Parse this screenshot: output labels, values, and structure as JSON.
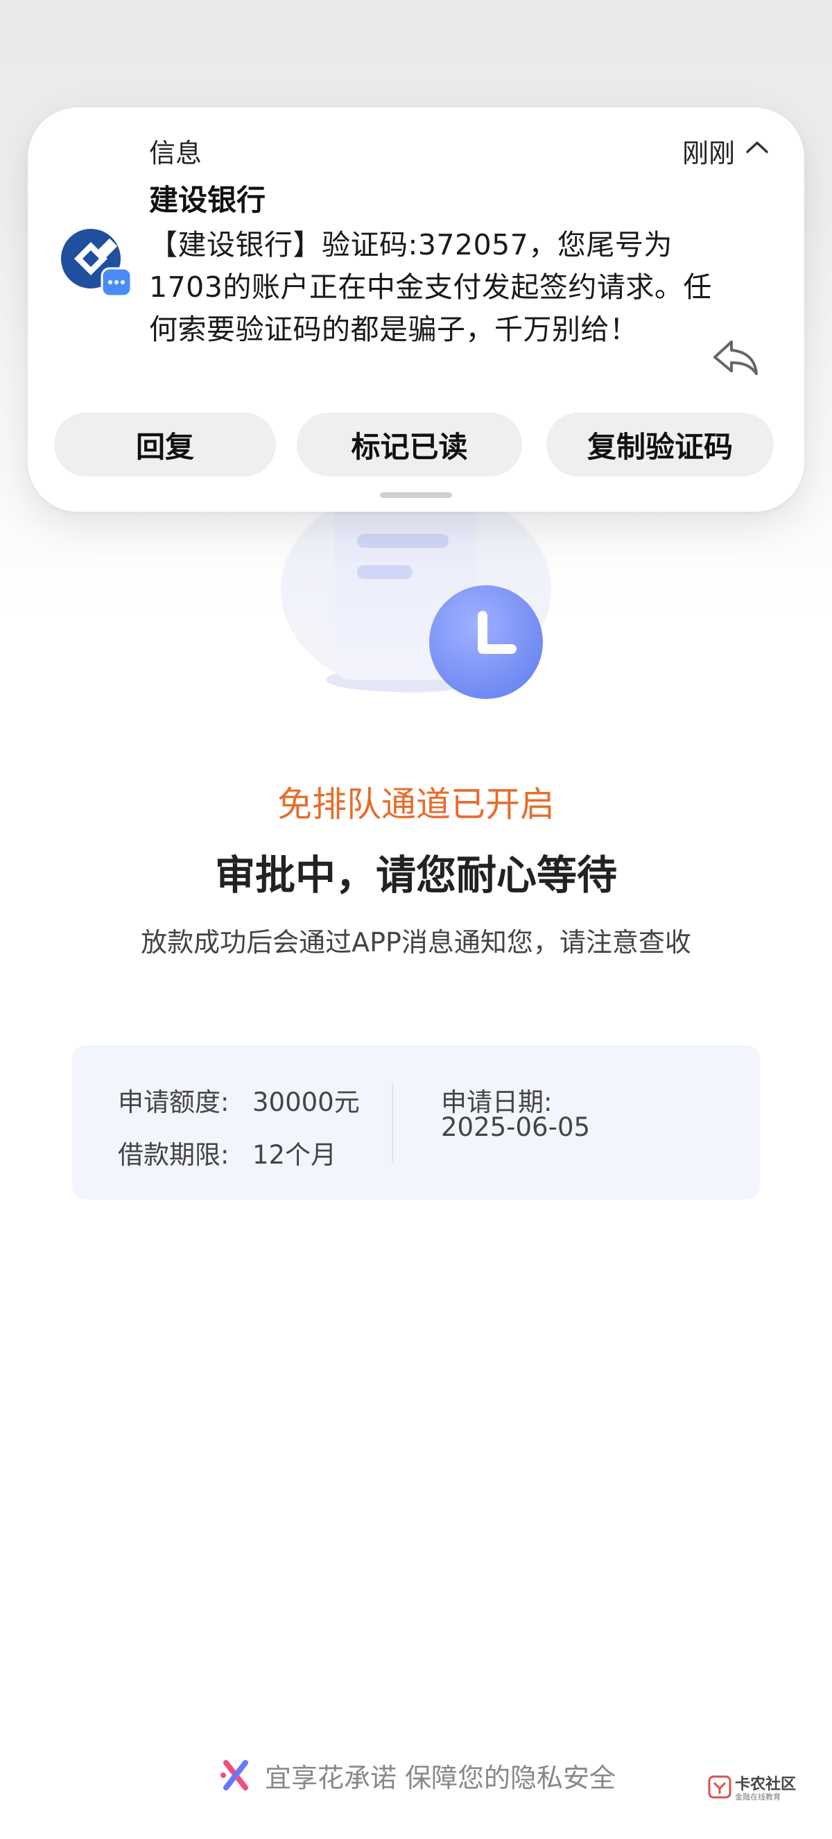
{
  "notification": {
    "app_name": "信息",
    "time": "刚刚",
    "sender": "建设银行",
    "body": "【建设银行】验证码:372057，您尾号为1703的账户正在中金支付发起签约请求。任何索要验证码的都是骗子，千万别给！",
    "actions": [
      "回复",
      "标记已读",
      "复制验证码"
    ]
  },
  "status": {
    "fast_lane": "免排队通道已开启",
    "title": "审批中，请您耐心等待",
    "subtitle": "放款成功后会通过APP消息通知您，请注意查收"
  },
  "info": {
    "amount_label": "申请额度:",
    "amount_value": "30000元",
    "term_label": "借款期限:",
    "term_value": "12个月",
    "date_label": "申请日期:",
    "date_value": "2025-06-05"
  },
  "footer": {
    "text": "宜享花承诺 保障您的隐私安全"
  },
  "watermark": {
    "title": "卡农社区",
    "subtitle": "金融在线教育"
  },
  "colors": {
    "accent_orange": "#e76d2a",
    "clock_blue": "#7b93f6",
    "info_bg": "#f3f5fd",
    "ccb_blue": "#1f4f9e"
  },
  "icons": {
    "bank_logo": "ccb-logo-icon",
    "message_badge": "message-badge-icon",
    "reply": "reply-icon",
    "collapse": "chevron-up-icon",
    "clock": "clock-icon",
    "document": "document-icon",
    "brand": "yixianghua-logo-icon"
  }
}
